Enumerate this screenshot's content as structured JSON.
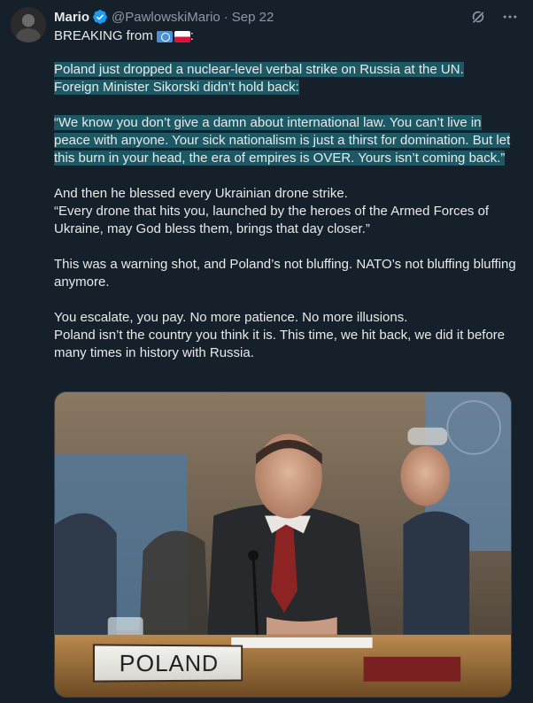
{
  "author": {
    "name": "Mario",
    "handle": "@PawlowskiMario",
    "date": "Sep 22"
  },
  "icons": {
    "verified": "verified-badge-icon",
    "grok": "grok-icon",
    "more": "more-icon",
    "flag_un": "flag-un-icon",
    "flag_pl": "flag-poland-icon"
  },
  "colors": {
    "background": "#15202b",
    "highlight": "#1d5965",
    "verified": "#1d9bf0",
    "muted": "#8b98a5"
  },
  "tweet": {
    "breaking": "BREAKING from",
    "breaking_suffix": ":",
    "para1_line1": "Poland just dropped a nuclear-level verbal strike on Russia at the UN.",
    "para1_line2": "Foreign Minister Sikorski didn’t hold back:",
    "para2": "“We know you don’t give a damn about international law. You can’t live in peace with anyone. Your sick nationalism is just a thirst for domination. But let this burn in your head, the era of empires is OVER. Yours isn’t coming back.”",
    "para3_line1": "And then he blessed every Ukrainian drone strike.",
    "para3_line2": "“Every drone that hits you, launched by the heroes of the Armed Forces of Ukraine, may God bless them, brings that day closer.”",
    "para4": "This was a warning shot, and Poland’s not bluffing. NATO’s not bluffing bluffing anymore.",
    "para5_line1": "You escalate, you pay. No more patience. No more illusions.",
    "para5_line2": "Poland isn’t the country you think it is. This time, we hit back, we did it before many times in history with Russia."
  },
  "media": {
    "placard_text": "POLAND"
  }
}
